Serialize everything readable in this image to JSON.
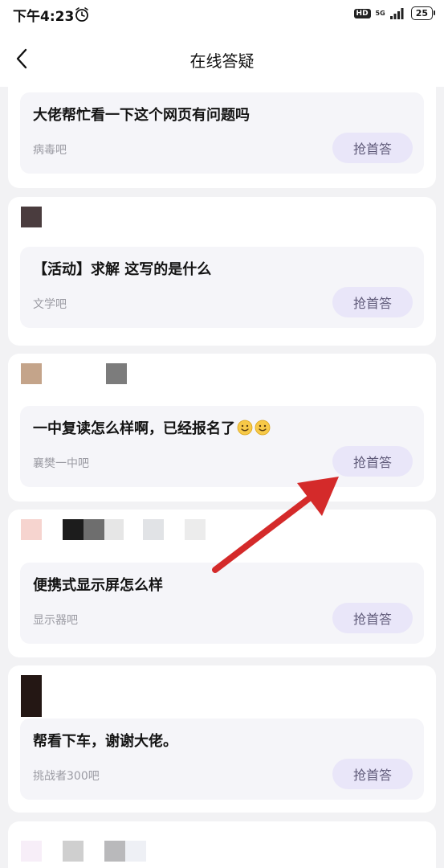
{
  "status_bar": {
    "time": "下午4:23",
    "hd_label": "HD",
    "network_label": "5G",
    "battery": "25"
  },
  "nav": {
    "title": "在线答疑",
    "back_icon": "chevron-left-icon"
  },
  "questions": [
    {
      "title": "大佬帮忙看一下这个网页有问题吗",
      "forum": "病毒吧",
      "action": "抢首答"
    },
    {
      "title": "【活动】求解 这写的是什么",
      "forum": "文学吧",
      "action": "抢首答"
    },
    {
      "title": "一中复读怎么样啊，已经报名了",
      "title_emoji": [
        "slightly-smiling-face",
        "slightly-smiling-face"
      ],
      "forum": "襄樊一中吧",
      "action": "抢首答"
    },
    {
      "title": "便携式显示屏怎么样",
      "forum": "显示器吧",
      "action": "抢首答"
    },
    {
      "title": "帮看下车，谢谢大佬。",
      "forum": "挑战者300吧",
      "action": "抢首答"
    }
  ],
  "annotation": {
    "type": "red-arrow",
    "color": "#d42a2a",
    "points_to": "抢首答"
  }
}
